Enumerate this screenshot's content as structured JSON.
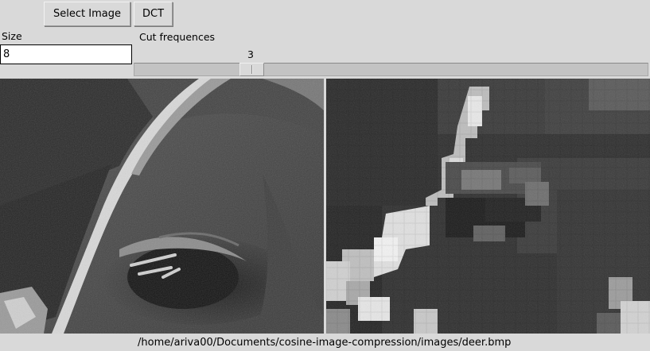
{
  "toolbar": {
    "select_image_label": "Select Image",
    "dct_label": "DCT"
  },
  "size": {
    "label": "Size",
    "value": "8"
  },
  "cut": {
    "label": "Cut frequences",
    "value": "3"
  },
  "status": {
    "path": "/home/ariva00/Documents/cosine-image-compression/images/deer.bmp"
  }
}
